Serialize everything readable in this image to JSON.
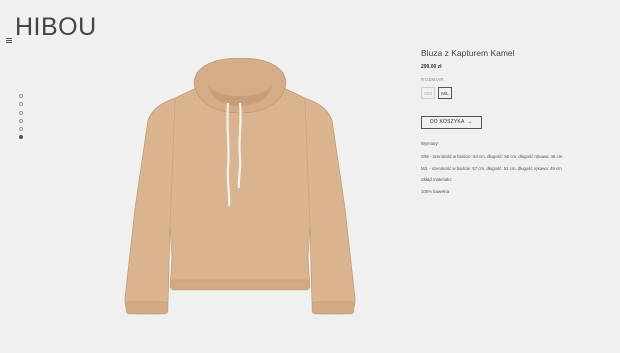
{
  "brand": {
    "logo": "HIBOU"
  },
  "gallery": {
    "slide_count": 6,
    "active_index": 5
  },
  "product": {
    "title": "Bluza z Kapturem Kamel",
    "price": "299.00 zł",
    "size_label": "ROZMIAR",
    "sizes": [
      "S/M",
      "M/L"
    ],
    "selected_size": "M/L",
    "add_to_cart_label": "DO KOSZYKA",
    "arrow_icon": "→",
    "description": {
      "dimensions_heading": "Wymiary:",
      "dimension_lines": [
        "S/M - szerokość w biuście: 54 cm, długość: 50 cm, długość rękawa: 46 cm",
        "M/L - szerokość w biuście: 57 cm, długość: 52 cm, długość rękawa: 49 cm"
      ],
      "material_heading": "Skład materiału:",
      "material": "100% bawełna"
    },
    "colors": {
      "hoodie": "#d9b48f",
      "accent": "#555555"
    }
  }
}
